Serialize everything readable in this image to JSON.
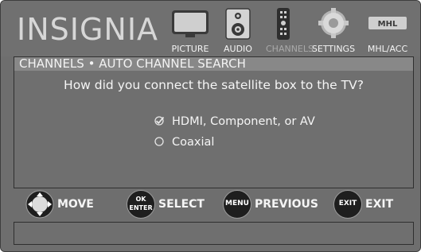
{
  "brand": "INSIGNIA",
  "nav": {
    "picture": "PICTURE",
    "audio": "AUDIO",
    "channels": "CHANNELS",
    "settings": "SETTINGS",
    "mhl": "MHL/ACC",
    "mhl_logo": "MHL"
  },
  "menu": {
    "title": "CHANNELS • AUTO CHANNEL SEARCH",
    "question": "How did you connect the satellite box to the TV?",
    "options": [
      {
        "label": "HDMI, Component, or AV",
        "selected": true
      },
      {
        "label": "Coaxial",
        "selected": false
      }
    ]
  },
  "hints": {
    "move": "MOVE",
    "select": "SELECT",
    "select_btn_top": "OK",
    "select_btn_bottom": "ENTER",
    "previous": "PREVIOUS",
    "previous_btn": "MENU",
    "exit": "EXIT",
    "exit_btn": "EXIT"
  },
  "colors": {
    "background": "#6e6e6e",
    "title_strip": "#888888",
    "text": "#f5f5f5",
    "dim_text": "#a9a9a9",
    "button": "#1e1e1e"
  }
}
